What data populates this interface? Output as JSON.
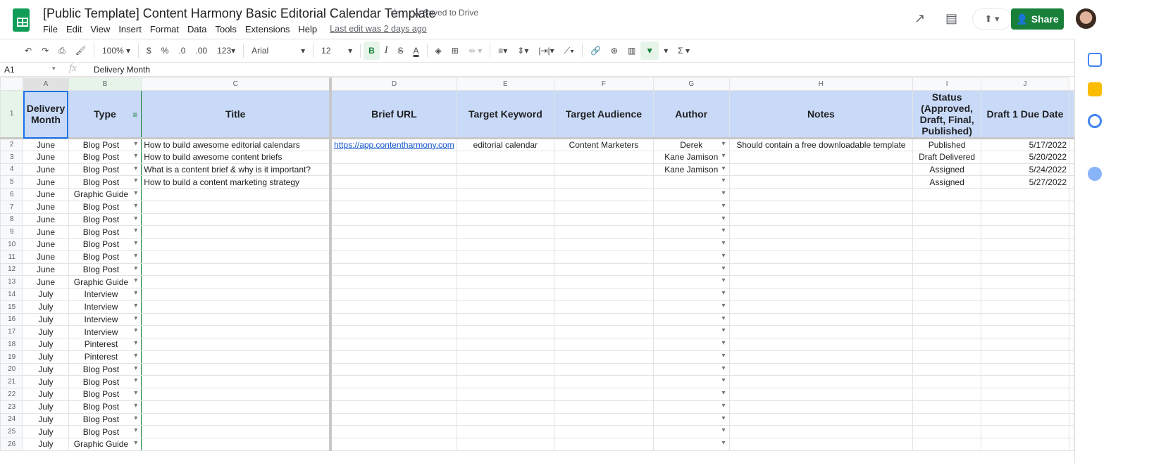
{
  "app": {
    "title": "[Public Template] Content Harmony Basic Editorial Calendar Template",
    "saved": "Saved to Drive",
    "last_edit": "Last edit was 2 days ago",
    "share": "Share",
    "menu": [
      "File",
      "Edit",
      "View",
      "Insert",
      "Format",
      "Data",
      "Tools",
      "Extensions",
      "Help"
    ]
  },
  "toolbar": {
    "zoom": "100%",
    "currency": "$",
    "percent": "%",
    "dec_less": ".0",
    "dec_more": ".00",
    "format": "123",
    "font": "Arial",
    "size": "12",
    "bold": "B",
    "italic": "I",
    "strike": "S",
    "color": "A",
    "sum": "Σ"
  },
  "formula": {
    "cell": "A1",
    "fx": "fx",
    "value": "Delivery Month"
  },
  "columns": [
    "A",
    "B",
    "C",
    "D",
    "E",
    "F",
    "G",
    "H",
    "I",
    "J"
  ],
  "headers": [
    "Delivery Month",
    "Type",
    "Title",
    "Brief URL",
    "Target Keyword",
    "Target Audience",
    "Author",
    "Notes",
    "Status (Approved, Draft, Final, Published)",
    "Draft 1 Due Date"
  ],
  "rows": [
    [
      "June",
      "Blog Post",
      "How to build awesome editorial calendars",
      "https://app.contentharmony.com",
      "editorial calendar",
      "Content Marketers",
      "Derek",
      "Should contain a free downloadable template",
      "Published",
      "5/17/2022"
    ],
    [
      "June",
      "Blog Post",
      "How to build awesome content briefs",
      "",
      "",
      "",
      "Kane Jamison",
      "",
      "Draft Delivered",
      "5/20/2022"
    ],
    [
      "June",
      "Blog Post",
      "What is a content brief & why is it important?",
      "",
      "",
      "",
      "Kane Jamison",
      "",
      "Assigned",
      "5/24/2022"
    ],
    [
      "June",
      "Blog Post",
      "How to build a content marketing strategy",
      "",
      "",
      "",
      "",
      "",
      "Assigned",
      "5/27/2022"
    ],
    [
      "June",
      "Graphic Guide",
      "",
      "",
      "",
      "",
      "",
      "",
      "",
      ""
    ],
    [
      "June",
      "Blog Post",
      "",
      "",
      "",
      "",
      "",
      "",
      "",
      ""
    ],
    [
      "June",
      "Blog Post",
      "",
      "",
      "",
      "",
      "",
      "",
      "",
      ""
    ],
    [
      "June",
      "Blog Post",
      "",
      "",
      "",
      "",
      "",
      "",
      "",
      ""
    ],
    [
      "June",
      "Blog Post",
      "",
      "",
      "",
      "",
      "",
      "",
      "",
      ""
    ],
    [
      "June",
      "Blog Post",
      "",
      "",
      "",
      "",
      "",
      "",
      "",
      ""
    ],
    [
      "June",
      "Blog Post",
      "",
      "",
      "",
      "",
      "",
      "",
      "",
      ""
    ],
    [
      "June",
      "Graphic Guide",
      "",
      "",
      "",
      "",
      "",
      "",
      "",
      ""
    ],
    [
      "July",
      "Interview",
      "",
      "",
      "",
      "",
      "",
      "",
      "",
      ""
    ],
    [
      "July",
      "Interview",
      "",
      "",
      "",
      "",
      "",
      "",
      "",
      ""
    ],
    [
      "July",
      "Interview",
      "",
      "",
      "",
      "",
      "",
      "",
      "",
      ""
    ],
    [
      "July",
      "Interview",
      "",
      "",
      "",
      "",
      "",
      "",
      "",
      ""
    ],
    [
      "July",
      "Pinterest",
      "",
      "",
      "",
      "",
      "",
      "",
      "",
      ""
    ],
    [
      "July",
      "Pinterest",
      "",
      "",
      "",
      "",
      "",
      "",
      "",
      ""
    ],
    [
      "July",
      "Blog Post",
      "",
      "",
      "",
      "",
      "",
      "",
      "",
      ""
    ],
    [
      "July",
      "Blog Post",
      "",
      "",
      "",
      "",
      "",
      "",
      "",
      ""
    ],
    [
      "July",
      "Blog Post",
      "",
      "",
      "",
      "",
      "",
      "",
      "",
      ""
    ],
    [
      "July",
      "Blog Post",
      "",
      "",
      "",
      "",
      "",
      "",
      "",
      ""
    ],
    [
      "July",
      "Blog Post",
      "",
      "",
      "",
      "",
      "",
      "",
      "",
      ""
    ],
    [
      "July",
      "Blog Post",
      "",
      "",
      "",
      "",
      "",
      "",
      "",
      ""
    ],
    [
      "July",
      "Graphic Guide",
      "",
      "",
      "",
      "",
      "",
      "",
      "",
      ""
    ]
  ],
  "colors": {
    "header_fill": "#c9daf8",
    "share": "#188038",
    "selection": "#1a73e8"
  }
}
